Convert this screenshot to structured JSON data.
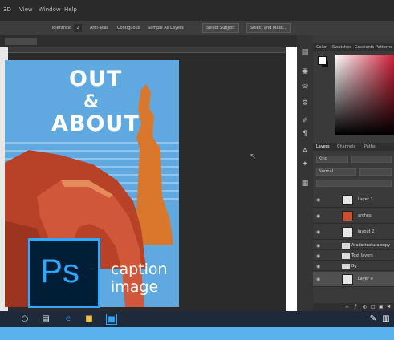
{
  "menubar": {
    "items": [
      "3D",
      "View",
      "Window",
      "Help"
    ]
  },
  "options_bar": {
    "tolerance_label": "Tolerance:",
    "tolerance_value": "2",
    "anti_alias": "Anti-alias",
    "contiguous": "Contiguous",
    "sample_all_layers": "Sample All Layers",
    "select_subject": "Select Subject",
    "select_and_mask": "Select and Mask..."
  },
  "poster": {
    "line1": "OUT",
    "line2": "&",
    "line3": "ABOUT",
    "caption1": "caption",
    "caption2": "image"
  },
  "ps_logo": {
    "text": "Ps"
  },
  "color_panel": {
    "tabs": [
      "Color",
      "Swatches",
      "Gradients",
      "Patterns"
    ]
  },
  "layers_panel": {
    "tabs": [
      "Layers",
      "Channels",
      "Paths"
    ],
    "kind_value": "Kind",
    "blend_mode": "Normal",
    "rows": [
      {
        "name": "Layer 1",
        "type": "layer"
      },
      {
        "name": "arches",
        "type": "art"
      },
      {
        "name": "layout 2",
        "type": "layer"
      },
      {
        "name": "Arado textura copy",
        "type": "folder"
      },
      {
        "name": "Text layers",
        "type": "folder"
      },
      {
        "name": "Bg",
        "type": "folder"
      },
      {
        "name": "Layer 0",
        "type": "layer",
        "selected": true
      }
    ]
  },
  "colors": {
    "ps_blue": "#31a8ff",
    "ps_dark": "#001e36",
    "sky": "#5fa8e0",
    "rock": "#c9502e",
    "taskbar_band": "#58b2ee"
  }
}
